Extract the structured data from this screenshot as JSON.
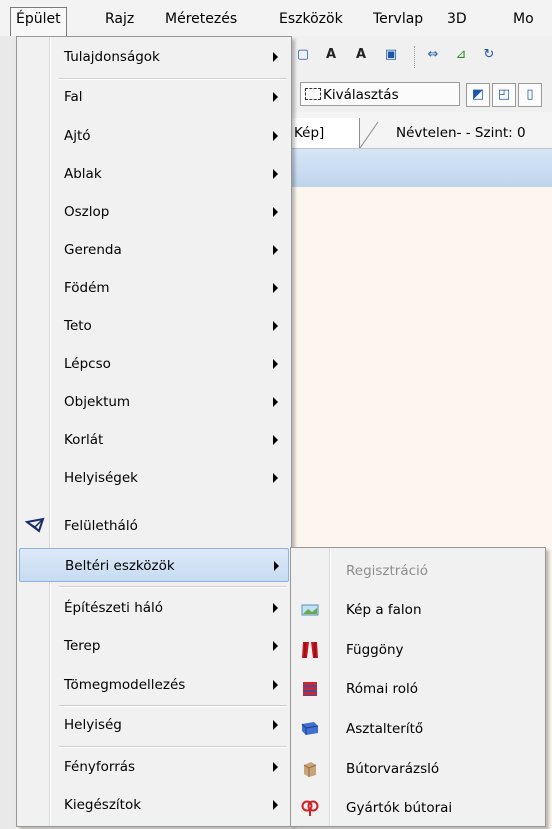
{
  "menubar": {
    "items": [
      "Épület",
      "Rajz",
      "Méretezés",
      "Eszközök",
      "Tervlap",
      "3D",
      "Mo"
    ]
  },
  "toolbar": {
    "select_label": "Kiválasztás"
  },
  "tabs": [
    "Kép]",
    "Névtelen- - Szint: 0"
  ],
  "menu": {
    "items": [
      {
        "label": "Tulajdonságok",
        "submenu": true
      },
      {
        "label": "Fal",
        "submenu": true
      },
      {
        "label": "Ajtó",
        "submenu": true
      },
      {
        "label": "Ablak",
        "submenu": true
      },
      {
        "label": "Oszlop",
        "submenu": true
      },
      {
        "label": "Gerenda",
        "submenu": true
      },
      {
        "label": "Födém",
        "submenu": true
      },
      {
        "label": "Teto",
        "submenu": true
      },
      {
        "label": "Lépcso",
        "submenu": true
      },
      {
        "label": "Objektum",
        "submenu": true
      },
      {
        "label": "Korlát",
        "submenu": true
      },
      {
        "label": "Helyiségek",
        "submenu": true
      },
      {
        "label": "Felületháló",
        "submenu": false,
        "icon": "mesh-icon"
      },
      {
        "label": "Beltéri eszközök",
        "submenu": true,
        "highlighted": true
      },
      {
        "label": "Építészeti háló",
        "submenu": true
      },
      {
        "label": "Terep",
        "submenu": true
      },
      {
        "label": "Tömegmodellezés",
        "submenu": true
      },
      {
        "label": "Helyiség",
        "submenu": true
      },
      {
        "label": "Fényforrás",
        "submenu": true
      },
      {
        "label": "Kiegészítok",
        "submenu": true
      }
    ]
  },
  "submenu": {
    "items": [
      {
        "label": "Regisztráció",
        "disabled": true,
        "icon": ""
      },
      {
        "label": "Kép a falon",
        "disabled": false,
        "icon": "picture-icon"
      },
      {
        "label": "Függöny",
        "disabled": false,
        "icon": "curtain-icon"
      },
      {
        "label": "Római roló",
        "disabled": false,
        "icon": "roman-blind-icon"
      },
      {
        "label": "Asztalterítő",
        "disabled": false,
        "icon": "tablecloth-icon"
      },
      {
        "label": "Bútorvarázsló",
        "disabled": false,
        "icon": "furniture-wizard-icon"
      },
      {
        "label": "Gyártók bútorai",
        "disabled": false,
        "icon": "manufacturer-furniture-icon"
      }
    ]
  },
  "colors": {
    "highlight": "#c7dcf2",
    "titlebar": "#bfd4ec",
    "canvas": "#fdf6ee"
  }
}
